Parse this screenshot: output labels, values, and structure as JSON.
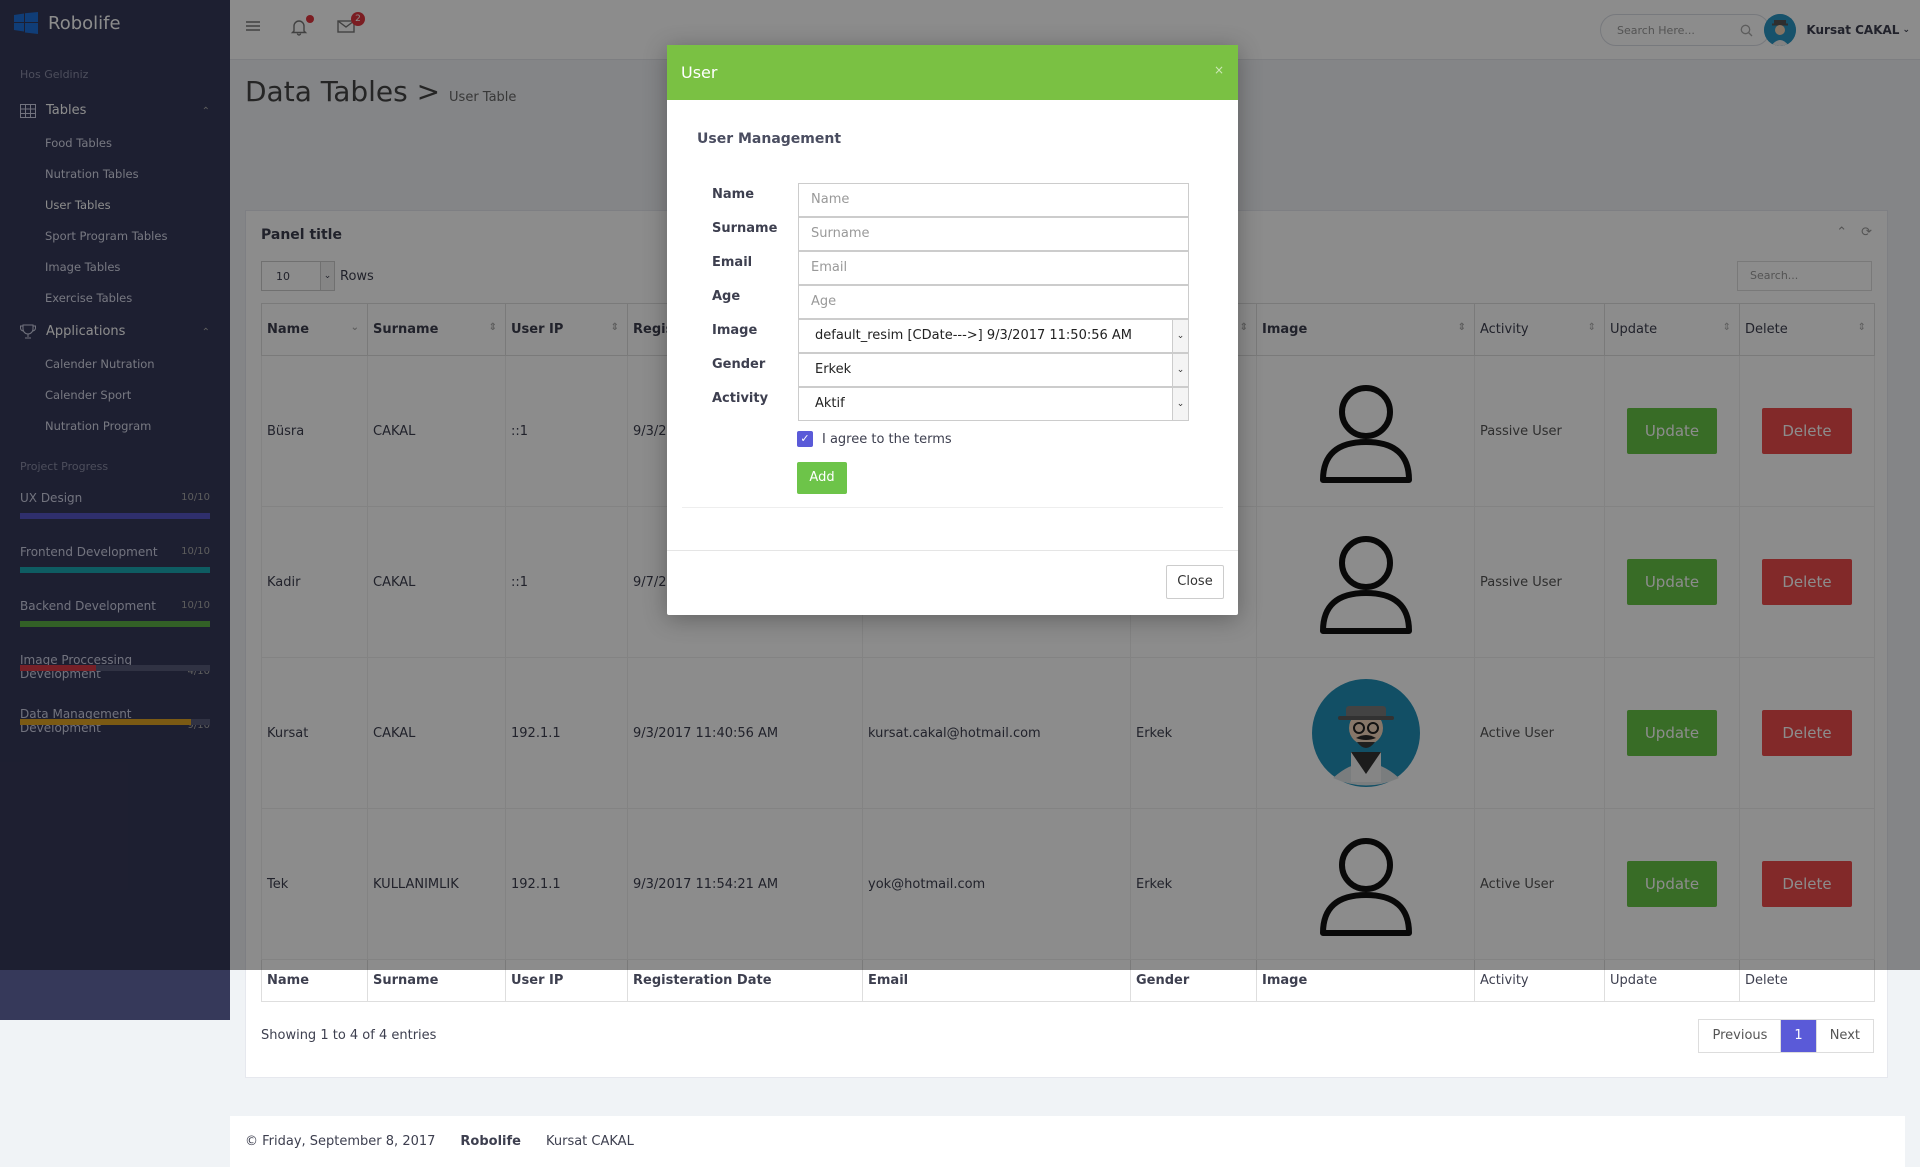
{
  "app": {
    "brand": "Robolife",
    "welcome": "Hos Geldiniz"
  },
  "sidebar": {
    "groups": [
      {
        "title": "Tables",
        "icon": "table-icon",
        "items": [
          "Food Tables",
          "Nutration Tables",
          "User Tables",
          "Sport Program Tables",
          "Image Tables",
          "Exercise Tables"
        ]
      },
      {
        "title": "Applications",
        "icon": "trophy-icon",
        "items": [
          "Calender Nutration",
          "Calender Sport",
          "Nutration Program"
        ]
      }
    ],
    "progress_title": "Project Progress",
    "progress": [
      {
        "name": "UX Design",
        "value": "10/10",
        "fraction": 1.0,
        "color": "#5757c7"
      },
      {
        "name": "Frontend Development",
        "value": "10/10",
        "fraction": 1.0,
        "color": "#1ba8b3"
      },
      {
        "name": "Backend Development",
        "value": "10/10",
        "fraction": 1.0,
        "color": "#5cb046"
      },
      {
        "name": "Image Proccessing Development",
        "value": "4/10",
        "fraction": 0.4,
        "color": "#d93b48"
      },
      {
        "name": "Data Management Development",
        "value": "9/10",
        "fraction": 0.9,
        "color": "#e0a526"
      }
    ]
  },
  "topbar": {
    "notif_count": "2",
    "search_placeholder": "Search Here...",
    "user_name": "Kursat CAKAL"
  },
  "page": {
    "title": "Data Tables",
    "sep": ">",
    "crumb": "User Table"
  },
  "panel": {
    "title": "Panel title",
    "rows_value": "10",
    "rows_label": "Rows",
    "search_placeholder": "Search...",
    "columns": [
      "Name",
      "Surname",
      "User IP",
      "Registeration Date",
      "Email",
      "Gender",
      "Image",
      "Activity",
      "Update",
      "Delete"
    ],
    "header_visible": [
      "Name",
      "Surname",
      "User IP",
      "Regis",
      "",
      "",
      "Image",
      "Activity",
      "Update",
      "Delete"
    ],
    "rows": [
      {
        "name": "Büsra",
        "surname": "CAKAL",
        "ip": "::1",
        "date": "9/3/2",
        "email": "",
        "gender": "",
        "image": "person-icon",
        "activity": "Passive User",
        "update": "Update",
        "delete": "Delete"
      },
      {
        "name": "Kadir",
        "surname": "CAKAL",
        "ip": "::1",
        "date": "9/7/2",
        "email": "",
        "gender": "",
        "image": "person-icon",
        "activity": "Passive User",
        "update": "Update",
        "delete": "Delete"
      },
      {
        "name": "Kursat",
        "surname": "CAKAL",
        "ip": "192.1.1",
        "date": "9/3/2017 11:40:56 AM",
        "email": "kursat.cakal@hotmail.com",
        "gender": "Erkek",
        "image": "hipster-avatar",
        "activity": "Active User",
        "update": "Update",
        "delete": "Delete"
      },
      {
        "name": "Tek",
        "surname": "KULLANIMLIK",
        "ip": "192.1.1",
        "date": "9/3/2017 11:54:21 AM",
        "email": "yok@hotmail.com",
        "gender": "Erkek",
        "image": "person-icon",
        "activity": "Active User",
        "update": "Update",
        "delete": "Delete"
      }
    ],
    "showing": "Showing 1 to 4 of 4 entries",
    "pager": {
      "prev": "Previous",
      "current": "1",
      "next": "Next"
    }
  },
  "footer": {
    "date": "© Friday, September 8, 2017",
    "brand": "Robolife",
    "author": "Kursat CAKAL"
  },
  "modal": {
    "title": "User",
    "close_x": "×",
    "subtitle": "User Management",
    "fields": {
      "name": {
        "label": "Name",
        "placeholder": "Name"
      },
      "surname": {
        "label": "Surname",
        "placeholder": "Surname"
      },
      "email": {
        "label": "Email",
        "placeholder": "Email"
      },
      "age": {
        "label": "Age",
        "placeholder": "Age"
      },
      "image": {
        "label": "Image",
        "value": "default_resim [CDate--->] 9/3/2017 11:50:56 AM"
      },
      "gender": {
        "label": "Gender",
        "value": "Erkek"
      },
      "activity": {
        "label": "Activity",
        "value": "Aktif"
      }
    },
    "terms": "I agree to the terms",
    "add": "Add",
    "close": "Close"
  }
}
